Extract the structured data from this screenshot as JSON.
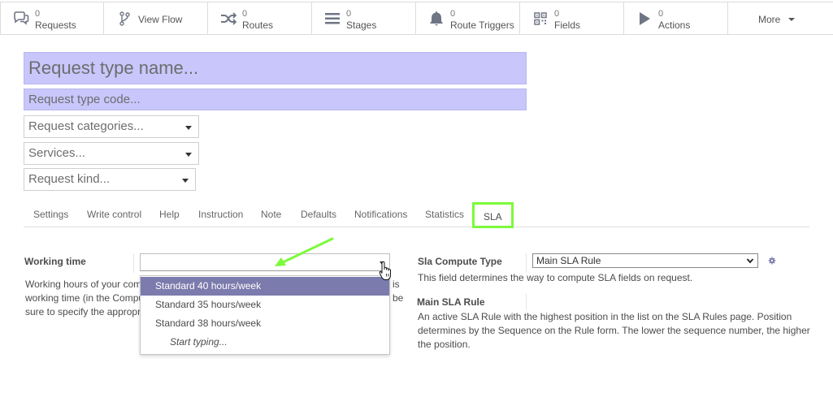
{
  "smart_buttons": [
    {
      "count": "0",
      "label": "Requests",
      "icon": "comments-icon"
    },
    {
      "count": "",
      "label": "View Flow",
      "icon": "flow-icon"
    },
    {
      "count": "0",
      "label": "Routes",
      "icon": "shuffle-icon"
    },
    {
      "count": "0",
      "label": "Stages",
      "icon": "bars-icon"
    },
    {
      "count": "0",
      "label": "Route Triggers",
      "icon": "bell-icon"
    },
    {
      "count": "0",
      "label": "Fields",
      "icon": "qrcode-icon"
    },
    {
      "count": "0",
      "label": "Actions",
      "icon": "play-icon"
    },
    {
      "count": "",
      "label": "More",
      "icon": "caret-down-icon"
    }
  ],
  "form": {
    "name_placeholder": "Request type name...",
    "code_placeholder": "Request type code...",
    "categories_placeholder": "Request categories...",
    "services_placeholder": "Services...",
    "kind_placeholder": "Request kind..."
  },
  "tabs": [
    "Settings",
    "Write control",
    "Help",
    "Instruction",
    "Note",
    "Defaults",
    "Notifications",
    "Statistics",
    "SLA"
  ],
  "active_tab": "SLA",
  "sla": {
    "working_time_label": "Working time",
    "working_time_help": [
      "Working hours of your comp",
      "working time (in the Compu",
      "sure to specify the appropri"
    ],
    "working_time_help_tail": [
      "is",
      "be"
    ],
    "dropdown_options": [
      "Standard 40 hours/week",
      "Standard 35 hours/week",
      "Standard 38 hours/week"
    ],
    "dropdown_hint": "Start typing...",
    "compute_type_label": "Sla Compute Type",
    "compute_type_value": "Main SLA Rule",
    "compute_type_help": "This field determines the way to compute SLA fields on request.",
    "main_rule_label": "Main SLA Rule",
    "main_rule_help": [
      "An active SLA Rule with the highest position in the list on the SLA Rules page. Position",
      "determines by the Sequence on the Rule form. The lower the sequence number, the higher",
      "the position."
    ]
  },
  "colors": {
    "required_field_bg": "#c8c6fb",
    "highlight_option": "#7c7bad",
    "annotation_green": "#7bfa3a"
  }
}
